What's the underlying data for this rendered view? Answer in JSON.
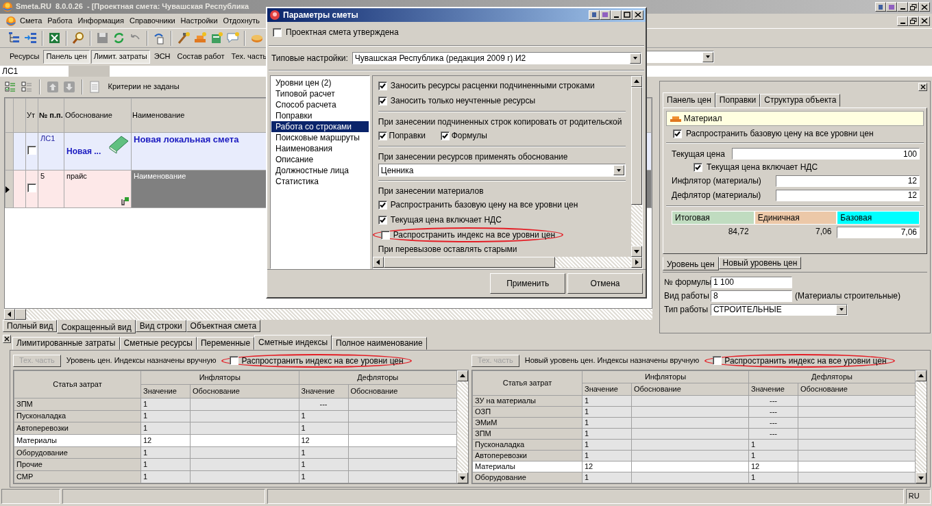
{
  "window": {
    "title": "Smeta.RU  8.0.0.26  - [Проектная смета: Чувашская Республика"
  },
  "menu": [
    "Смета",
    "Работа",
    "Информация",
    "Справочники",
    "Настройки",
    "Отдохнуть"
  ],
  "panel_buttons": [
    {
      "label": "Ресурсы",
      "pressed": false
    },
    {
      "label": "Панель цен",
      "pressed": true
    },
    {
      "label": "Лимит. затраты",
      "pressed": true
    },
    {
      "label": "ЭСН",
      "pressed": false
    },
    {
      "label": "Состав работ",
      "pressed": false
    },
    {
      "label": "Тех. часть",
      "pressed": false
    }
  ],
  "address": "ЛС1",
  "grid": {
    "filter_text": "Критерии не заданы",
    "columns": [
      "Ут",
      "№ п.п.",
      "Обоснование",
      "Наименование"
    ],
    "rows": [
      {
        "kind": "estimate",
        "current": false,
        "selected": false,
        "checked": false,
        "number": "ЛС1",
        "basis": "Новая ...",
        "name": "Новая локальная смета"
      },
      {
        "kind": "item",
        "current": true,
        "selected": true,
        "checked": false,
        "number": "5",
        "basis": "прайс",
        "name": "Наименование"
      }
    ]
  },
  "view_tabs": [
    {
      "label": "Полный вид",
      "selected": false
    },
    {
      "label": "Сокращенный вид",
      "selected": true
    },
    {
      "label": "Вид строки",
      "selected": false
    },
    {
      "label": "Объектная смета",
      "selected": false
    }
  ],
  "right_panel": {
    "tabs": [
      {
        "label": "Панель цен",
        "selected": true
      },
      {
        "label": "Поправки",
        "selected": false
      },
      {
        "label": "Структура объекта",
        "selected": false
      }
    ],
    "resource_type": "Материал",
    "spread_base": {
      "label": "Распространить базовую цену на все уровни цен",
      "checked": true
    },
    "current_price": {
      "label": "Текущая цена",
      "value": "100"
    },
    "vat": {
      "label": "Текущая цена включает НДС",
      "checked": true
    },
    "inflator": {
      "label": "Инфлятор (материалы)",
      "value": "12"
    },
    "deflator": {
      "label": "Дефлятор (материалы)",
      "value": "12"
    },
    "prices": [
      {
        "label": "Итоговая",
        "color": "#c0dcc0",
        "value": "84,72"
      },
      {
        "label": "Единичная",
        "color": "#ecc8a8",
        "value": "7,06"
      },
      {
        "label": "Базовая",
        "color": "#00ffff",
        "value": "7,06"
      }
    ],
    "level_tabs": [
      {
        "label": "Уровень цен",
        "selected": true
      },
      {
        "label": "Новый уровень цен",
        "selected": false
      }
    ],
    "formula": {
      "label": "№ формулы",
      "value": "1 100"
    },
    "work_kind": {
      "label": "Вид работы",
      "value": "8",
      "note": "(Материалы строительные)"
    },
    "work_type": {
      "label": "Тип работы",
      "value": "СТРОИТЕЛЬНЫЕ"
    }
  },
  "bottom_tabs": [
    {
      "label": "Лимитированные затраты",
      "selected": false
    },
    {
      "label": "Сметные ресурсы",
      "selected": false
    },
    {
      "label": "Переменные",
      "selected": false
    },
    {
      "label": "Сметные индексы",
      "selected": true
    },
    {
      "label": "Полное наименование",
      "selected": false
    }
  ],
  "index_panels": [
    {
      "button": "Тех. часть",
      "caption": "Уровень цен. Индексы назначены вручную",
      "spread_index": {
        "label": "Распространить индекс на все уровни цен",
        "checked": false,
        "highlighted": true
      },
      "headers": [
        "Статья затрат",
        "Инфляторы",
        "Дефляторы"
      ],
      "sub_headers": [
        "Значение",
        "Обоснование",
        "Значение",
        "Обоснование"
      ],
      "rows": [
        {
          "article": "ЗПМ",
          "inflator": "1",
          "deflator": "---",
          "selected": false
        },
        {
          "article": "Пусконаладка",
          "inflator": "1",
          "deflator": "1",
          "selected": false
        },
        {
          "article": "Автоперевозки",
          "inflator": "1",
          "deflator": "1",
          "selected": false
        },
        {
          "article": "Материалы",
          "inflator": "12",
          "deflator": "12",
          "selected": true
        },
        {
          "article": "Оборудование",
          "inflator": "1",
          "deflator": "1",
          "selected": false
        },
        {
          "article": "Прочие",
          "inflator": "1",
          "deflator": "1",
          "selected": false
        },
        {
          "article": "СМР",
          "inflator": "1",
          "deflator": "1",
          "selected": false
        }
      ]
    },
    {
      "button": "Тех. часть",
      "caption": "Новый уровень цен. Индексы назначены вручную",
      "spread_index": {
        "label": "Распространить индекс на все уровни цен",
        "checked": false,
        "highlighted": true
      },
      "headers": [
        "Статья затрат",
        "Инфляторы",
        "Дефляторы"
      ],
      "sub_headers": [
        "Значение",
        "Обоснование",
        "Значение",
        "Обоснование"
      ],
      "rows": [
        {
          "article": "ЗУ на материалы",
          "inflator": "1",
          "deflator": "---",
          "selected": false
        },
        {
          "article": "ОЗП",
          "inflator": "1",
          "deflator": "---",
          "selected": false
        },
        {
          "article": "ЭМиМ",
          "inflator": "1",
          "deflator": "---",
          "selected": false
        },
        {
          "article": "ЗПМ",
          "inflator": "1",
          "deflator": "---",
          "selected": false
        },
        {
          "article": "Пусконаладка",
          "inflator": "1",
          "deflator": "1",
          "selected": false
        },
        {
          "article": "Автоперевозки",
          "inflator": "1",
          "deflator": "1",
          "selected": false
        },
        {
          "article": "Материалы",
          "inflator": "12",
          "deflator": "12",
          "selected": true
        },
        {
          "article": "Оборудование",
          "inflator": "1",
          "deflator": "1",
          "selected": false
        }
      ]
    }
  ],
  "status_bar": {
    "language": "RU"
  },
  "dialog": {
    "title": "Параметры сметы",
    "approved": {
      "label": "Проектная смета утверждена",
      "checked": false
    },
    "preset": {
      "label": "Типовые настройки:",
      "value": "Чувашская Республика (редакция 2009 г) И2"
    },
    "sections": [
      {
        "label": "Уровни цен (2)",
        "selected": false
      },
      {
        "label": "Типовой расчет",
        "selected": false
      },
      {
        "label": "Способ расчета",
        "selected": false
      },
      {
        "label": "Поправки",
        "selected": false
      },
      {
        "label": "Работа со строками",
        "selected": true
      },
      {
        "label": "Поисковые маршруты",
        "selected": false
      },
      {
        "label": "Наименования",
        "selected": false
      },
      {
        "label": "Описание",
        "selected": false
      },
      {
        "label": "Должностные лица",
        "selected": false
      },
      {
        "label": "Статистика",
        "selected": false
      }
    ],
    "options": [
      {
        "kind": "checkbox",
        "label": "Заносить ресурсы расценки подчиненными строками",
        "checked": true,
        "highlighted": false
      },
      {
        "kind": "checkbox",
        "label": "Заносить только неучтенные ресурсы",
        "checked": true,
        "highlighted": false
      },
      {
        "kind": "divider"
      },
      {
        "kind": "heading",
        "label": "При занесении подчиненных строк копировать от родительской"
      },
      {
        "kind": "checkrow",
        "items": [
          {
            "label": "Поправки",
            "checked": true
          },
          {
            "label": "Формулы",
            "checked": true
          }
        ]
      },
      {
        "kind": "divider"
      },
      {
        "kind": "heading",
        "label": "При занесении ресурсов применять обоснование"
      },
      {
        "kind": "select",
        "value": "Ценника"
      },
      {
        "kind": "divider"
      },
      {
        "kind": "heading",
        "label": "При занесении материалов"
      },
      {
        "kind": "checkbox",
        "label": "Распространить базовую цену на все уровни цен",
        "checked": true,
        "highlighted": false
      },
      {
        "kind": "checkbox",
        "label": "Текущая цена включает НДС",
        "checked": true,
        "highlighted": false
      },
      {
        "kind": "checkbox",
        "label": "Распространить индекс на все уровни цен",
        "checked": false,
        "highlighted": true
      },
      {
        "kind": "heading",
        "label": "При перевызове оставлять старыми"
      }
    ],
    "buttons": [
      "Применить",
      "Отмена"
    ]
  }
}
